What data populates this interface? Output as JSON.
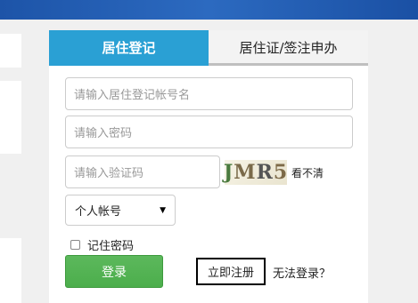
{
  "login": {
    "tabs": [
      {
        "label": "居住登记",
        "active": true
      },
      {
        "label": "居住证/签注申办",
        "active": false
      }
    ],
    "username_placeholder": "请输入居住登记帐号名",
    "password_placeholder": "请输入密码",
    "captcha_placeholder": "请输入验证码",
    "captcha_text": [
      "J",
      "M",
      "R",
      "5"
    ],
    "refresh_captcha": "看不清",
    "account_type": "个人帐号",
    "remember_label": "记住密码",
    "remember_checked": false,
    "login_button": "登录",
    "register_link": "立即注册",
    "cant_login_link": "无法登录？"
  },
  "colors": {
    "tab_active": "#2aa0d4",
    "login_button": "#5cb85c",
    "top_bar": "#1d54a8"
  }
}
